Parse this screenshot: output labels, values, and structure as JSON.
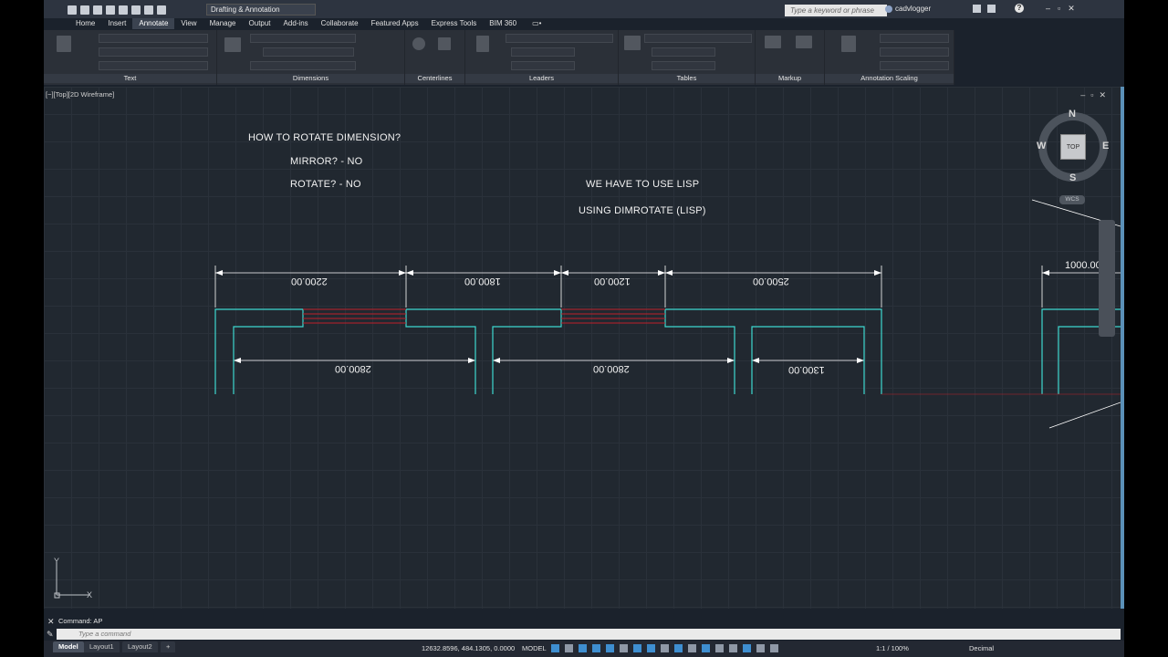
{
  "titlebar": {
    "workspace": "Drafting & Annotation",
    "search_placeholder": "Type a keyword or phrase",
    "user": "cadvlogger",
    "help": "?"
  },
  "tabs": [
    "Home",
    "Insert",
    "Annotate",
    "View",
    "Manage",
    "Output",
    "Add-ins",
    "Collaborate",
    "Featured Apps",
    "Express Tools",
    "BIM 360"
  ],
  "active_tab": "Annotate",
  "ribbon_panels": [
    "Text",
    "Dimensions",
    "Centerlines",
    "Leaders",
    "Tables",
    "Markup",
    "Annotation Scaling"
  ],
  "viewport": {
    "label": "[−][Top][2D Wireframe]",
    "notes": {
      "q1": "HOW TO ROTATE DIMENSION?",
      "q2": "MIRROR? - NO",
      "q3": "ROTATE? - NO",
      "a1": "WE HAVE TO USE LISP",
      "a2": "USING DIMROTATE (LISP)"
    },
    "dims_top": [
      "2200.00",
      "1800.00",
      "1200.00",
      "2500.00"
    ],
    "dims_bottom": [
      "2800.00",
      "2800.00",
      "1300.00"
    ],
    "dim_right": "1000.00"
  },
  "viewcube": {
    "n": "N",
    "s": "S",
    "e": "E",
    "w": "W",
    "top": "TOP",
    "wcs": "WCS"
  },
  "ucs": {
    "x": "X",
    "y": "Y"
  },
  "command": {
    "history": "Command: AP",
    "placeholder": "Type a command"
  },
  "layout_tabs": [
    "Model",
    "Layout1",
    "Layout2"
  ],
  "status": {
    "coords": "12632.8596, 484.1305, 0.0000",
    "space": "MODEL",
    "scale": "1:1 / 100%",
    "units": "Decimal"
  }
}
